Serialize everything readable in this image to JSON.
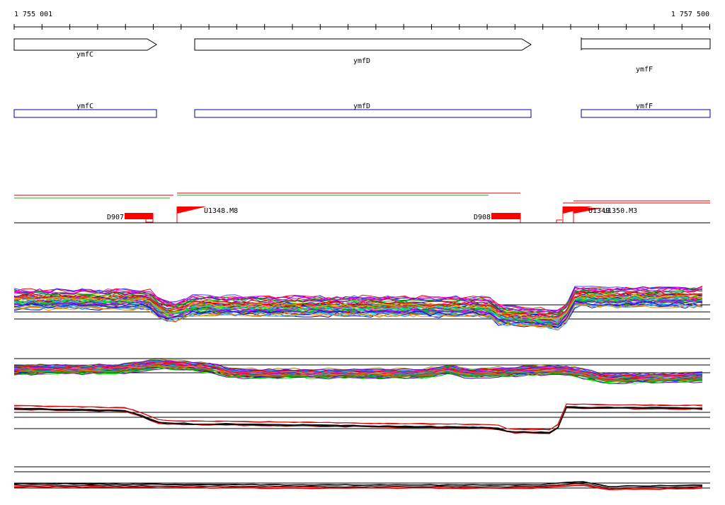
{
  "ruler": {
    "start_label": "1 755 001",
    "end_label": "1 757 500"
  },
  "genes": [
    {
      "name": "ymfC",
      "strand": "forward"
    },
    {
      "name": "ymfD",
      "strand": "forward"
    },
    {
      "name": "ymfF",
      "strand": "forward"
    }
  ],
  "cds": [
    {
      "name": "ymfC"
    },
    {
      "name": "ymfD"
    },
    {
      "name": "ymfF"
    }
  ],
  "features": [
    {
      "label": "D907"
    },
    {
      "label": "U1348.M8"
    },
    {
      "label": "D908"
    },
    {
      "label": "U1349"
    },
    {
      "label": "U1350.M3"
    }
  ],
  "colors": {
    "gene_outline": "#000000",
    "cds_outline": "#0000aa",
    "feature": "#ff0000",
    "green": "#22aa22",
    "red": "#dd0000",
    "black": "#000000"
  }
}
